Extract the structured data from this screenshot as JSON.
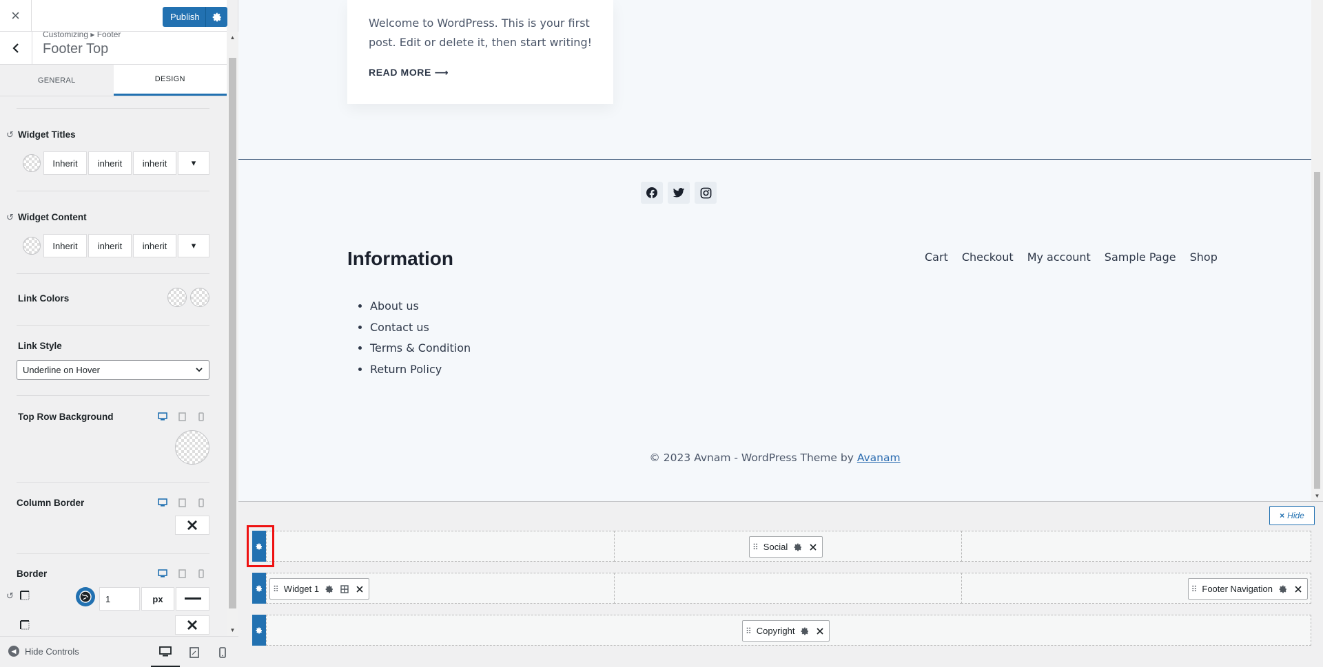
{
  "sidebar": {
    "close_label": "×",
    "publish_label": "Publish",
    "breadcrumb": "Customizing ▸ Footer",
    "section_title": "Footer Top",
    "tabs": [
      {
        "label": "GENERAL",
        "active": false
      },
      {
        "label": "DESIGN",
        "active": true
      }
    ],
    "widget_titles": {
      "label": "Widget Titles",
      "family": "Inherit",
      "weight": "inherit",
      "size": "inherit",
      "more": "▾"
    },
    "widget_content": {
      "label": "Widget Content",
      "family": "Inherit",
      "weight": "inherit",
      "size": "inherit",
      "more": "▾"
    },
    "link_colors_label": "Link Colors",
    "link_style": {
      "label": "Link Style",
      "value": "Underline on Hover"
    },
    "top_row_background_label": "Top Row Background",
    "column_border_label": "Column Border",
    "border": {
      "label": "Border",
      "width_value": "1",
      "unit": "px"
    },
    "hide_controls_label": "Hide Controls",
    "accent_color": "#2271b1"
  },
  "preview": {
    "post_excerpt": "Welcome to WordPress. This is your first post. Edit or delete it, then start writing!",
    "read_more": "READ MORE ⟶",
    "social_icons": [
      "facebook-icon",
      "twitter-icon",
      "instagram-icon"
    ],
    "info_title": "Information",
    "info_links": [
      "About us",
      "Contact us",
      "Terms & Condition",
      "Return Policy"
    ],
    "footer_nav": [
      "Cart",
      "Checkout",
      "My account",
      "Sample Page",
      "Shop"
    ],
    "copyright_text": "© 2023 Avnam - WordPress Theme by ",
    "copyright_link": "Avanam"
  },
  "builder": {
    "hide_label": "Hide",
    "row1_item": "Social",
    "row2_left_item": "Widget 1",
    "row2_right_item": "Footer Navigation",
    "row3_item": "Copyright"
  }
}
